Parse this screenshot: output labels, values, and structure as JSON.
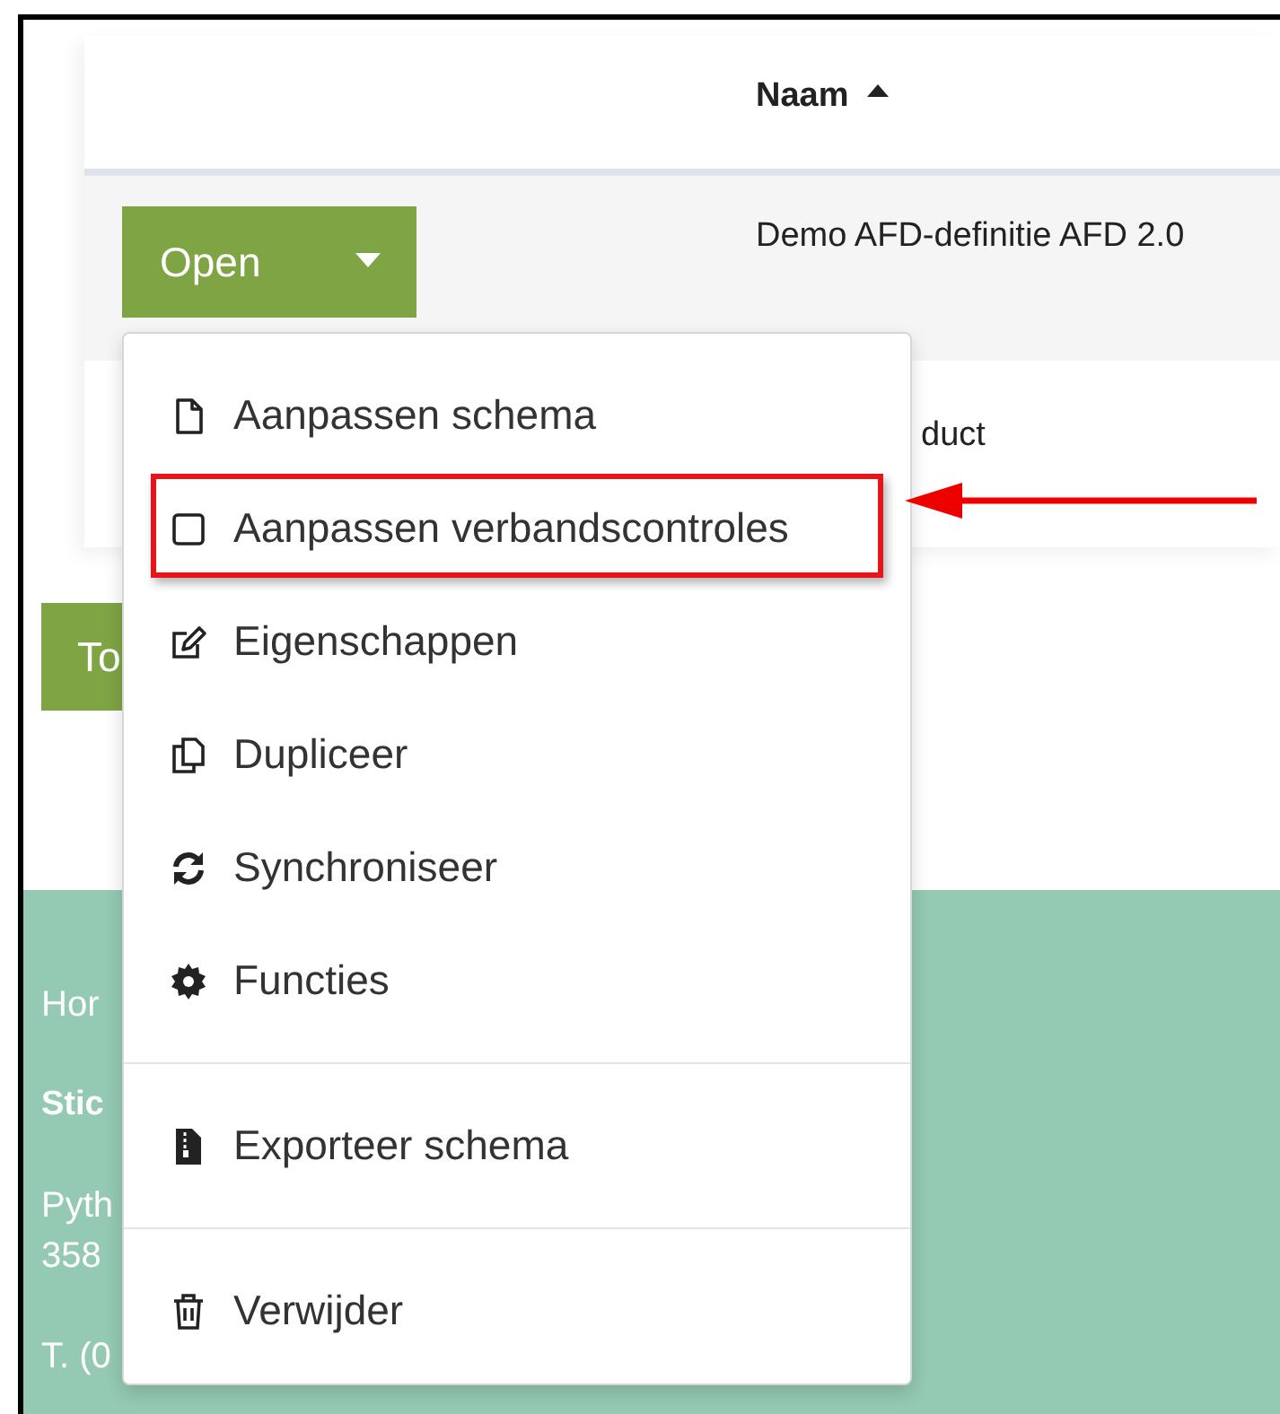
{
  "table": {
    "columns": [
      {
        "label": "Naam",
        "sorted_ascending": true
      }
    ],
    "rows": [
      {
        "action": "Open",
        "name": "Demo AFD-definitie AFD 2.0"
      },
      {
        "name": "duct"
      }
    ]
  },
  "button": "To",
  "footer": {
    "blocks": [
      {
        "kind": "text",
        "lines": [
          "Hor"
        ]
      },
      {
        "kind": "heading",
        "lines": [
          "Stic"
        ]
      },
      {
        "kind": "text",
        "lines": [
          "Pyth",
          "358"
        ]
      },
      {
        "kind": "text",
        "lines": [
          "T. (0"
        ]
      }
    ]
  },
  "menu": {
    "sections": [
      [
        {
          "label": "Aanpassen schema",
          "highlighted": false
        },
        {
          "label": "Aanpassen verbandscontroles",
          "highlighted": true
        },
        {
          "label": "Eigenschappen",
          "highlighted": false
        },
        {
          "label": "Dupliceer",
          "highlighted": false
        },
        {
          "label": "Synchroniseer",
          "highlighted": false
        },
        {
          "label": "Functies",
          "highlighted": false
        }
      ],
      [
        {
          "label": "Exporteer schema",
          "highlighted": false
        }
      ],
      [
        {
          "label": "Verwijder",
          "highlighted": false
        }
      ]
    ]
  }
}
